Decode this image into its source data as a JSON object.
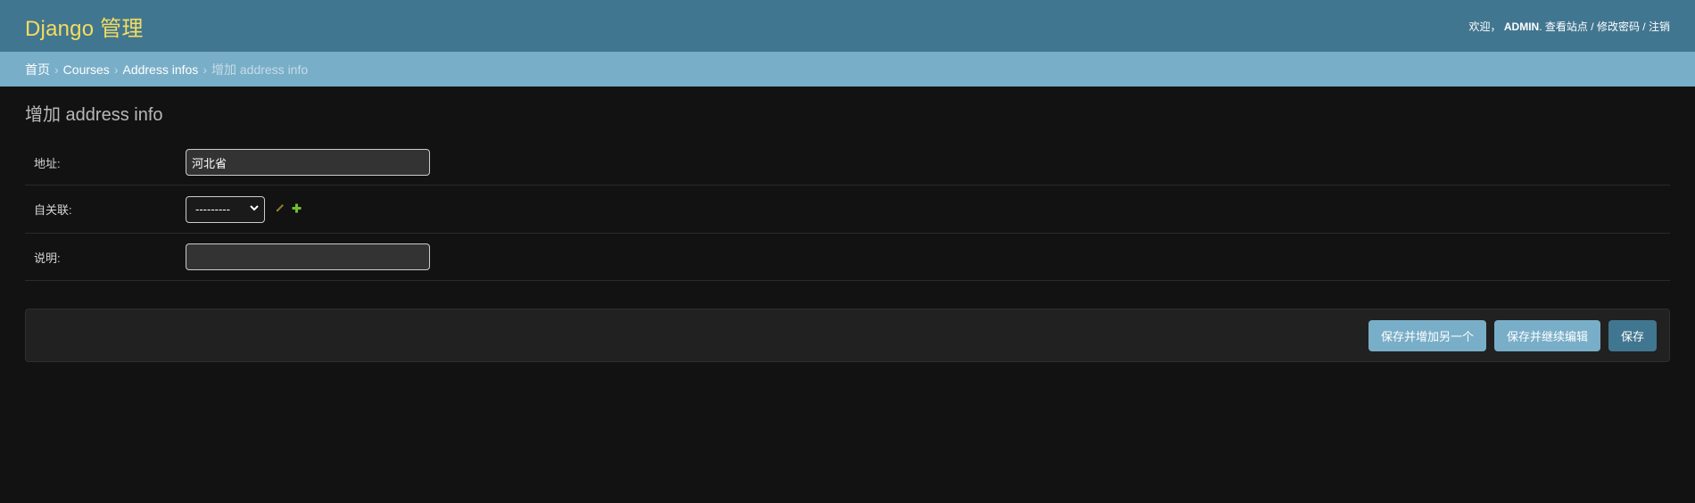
{
  "header": {
    "brand": "Django 管理",
    "welcome": "欢迎，",
    "username": "ADMIN",
    "username_suffix": ".",
    "links": [
      "查看站点",
      "修改密码",
      "注销"
    ],
    "separator": "/"
  },
  "breadcrumbs": {
    "items": [
      "首页",
      "Courses",
      "Address infos"
    ],
    "current": "增加 address info",
    "separator": "›"
  },
  "main": {
    "title": "增加 address info",
    "fields": {
      "address": {
        "label": "地址:",
        "value": "河北省"
      },
      "parent": {
        "label": "自关联:",
        "selected": "---------"
      },
      "description": {
        "label": "说明:",
        "value": ""
      }
    }
  },
  "actions": {
    "save_add_another": "保存并增加另一个",
    "save_continue": "保存并继续编辑",
    "save": "保存"
  },
  "colors": {
    "header_bg": "#417690",
    "brand": "#f5dd5d",
    "breadcrumbs_bg": "#79aec8",
    "page_bg": "#121212",
    "button_light": "#79aec8",
    "button_default": "#417690"
  },
  "icons": {
    "change_related": "pencil-icon",
    "add_related": "plus-icon",
    "select_arrow": "chevron-down-icon"
  }
}
